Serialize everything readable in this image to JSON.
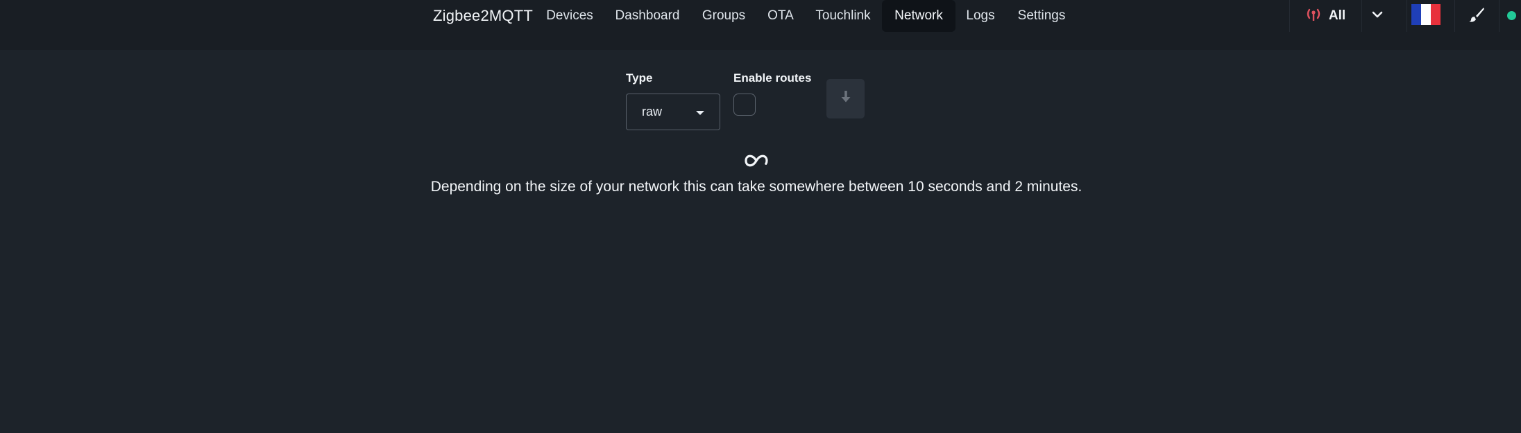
{
  "app": {
    "brand": "Zigbee2MQTT"
  },
  "nav": {
    "items": [
      {
        "label": "Devices"
      },
      {
        "label": "Dashboard"
      },
      {
        "label": "Groups"
      },
      {
        "label": "OTA"
      },
      {
        "label": "Touchlink"
      },
      {
        "label": "Network",
        "active": true
      },
      {
        "label": "Logs"
      },
      {
        "label": "Settings"
      }
    ]
  },
  "toolbar": {
    "instance_label": "All",
    "instance_icon": "antenna-icon",
    "dropdown_icon": "chevron-down-icon",
    "language_icon": "flag-fr-icon",
    "theme_icon": "paintbrush-icon",
    "status_color": "#22c997"
  },
  "network": {
    "type_label": "Type",
    "type_value": "raw",
    "enable_routes_label": "Enable routes",
    "enable_routes_checked": false,
    "download_icon": "download-icon",
    "loading_icon": "infinity-spinner-icon",
    "info_text": "Depending on the size of your network this can take somewhere between 10 seconds and 2 minutes."
  },
  "colors": {
    "background": "#1d232a",
    "navbar": "#191e24",
    "accent_red": "#e0525f"
  }
}
